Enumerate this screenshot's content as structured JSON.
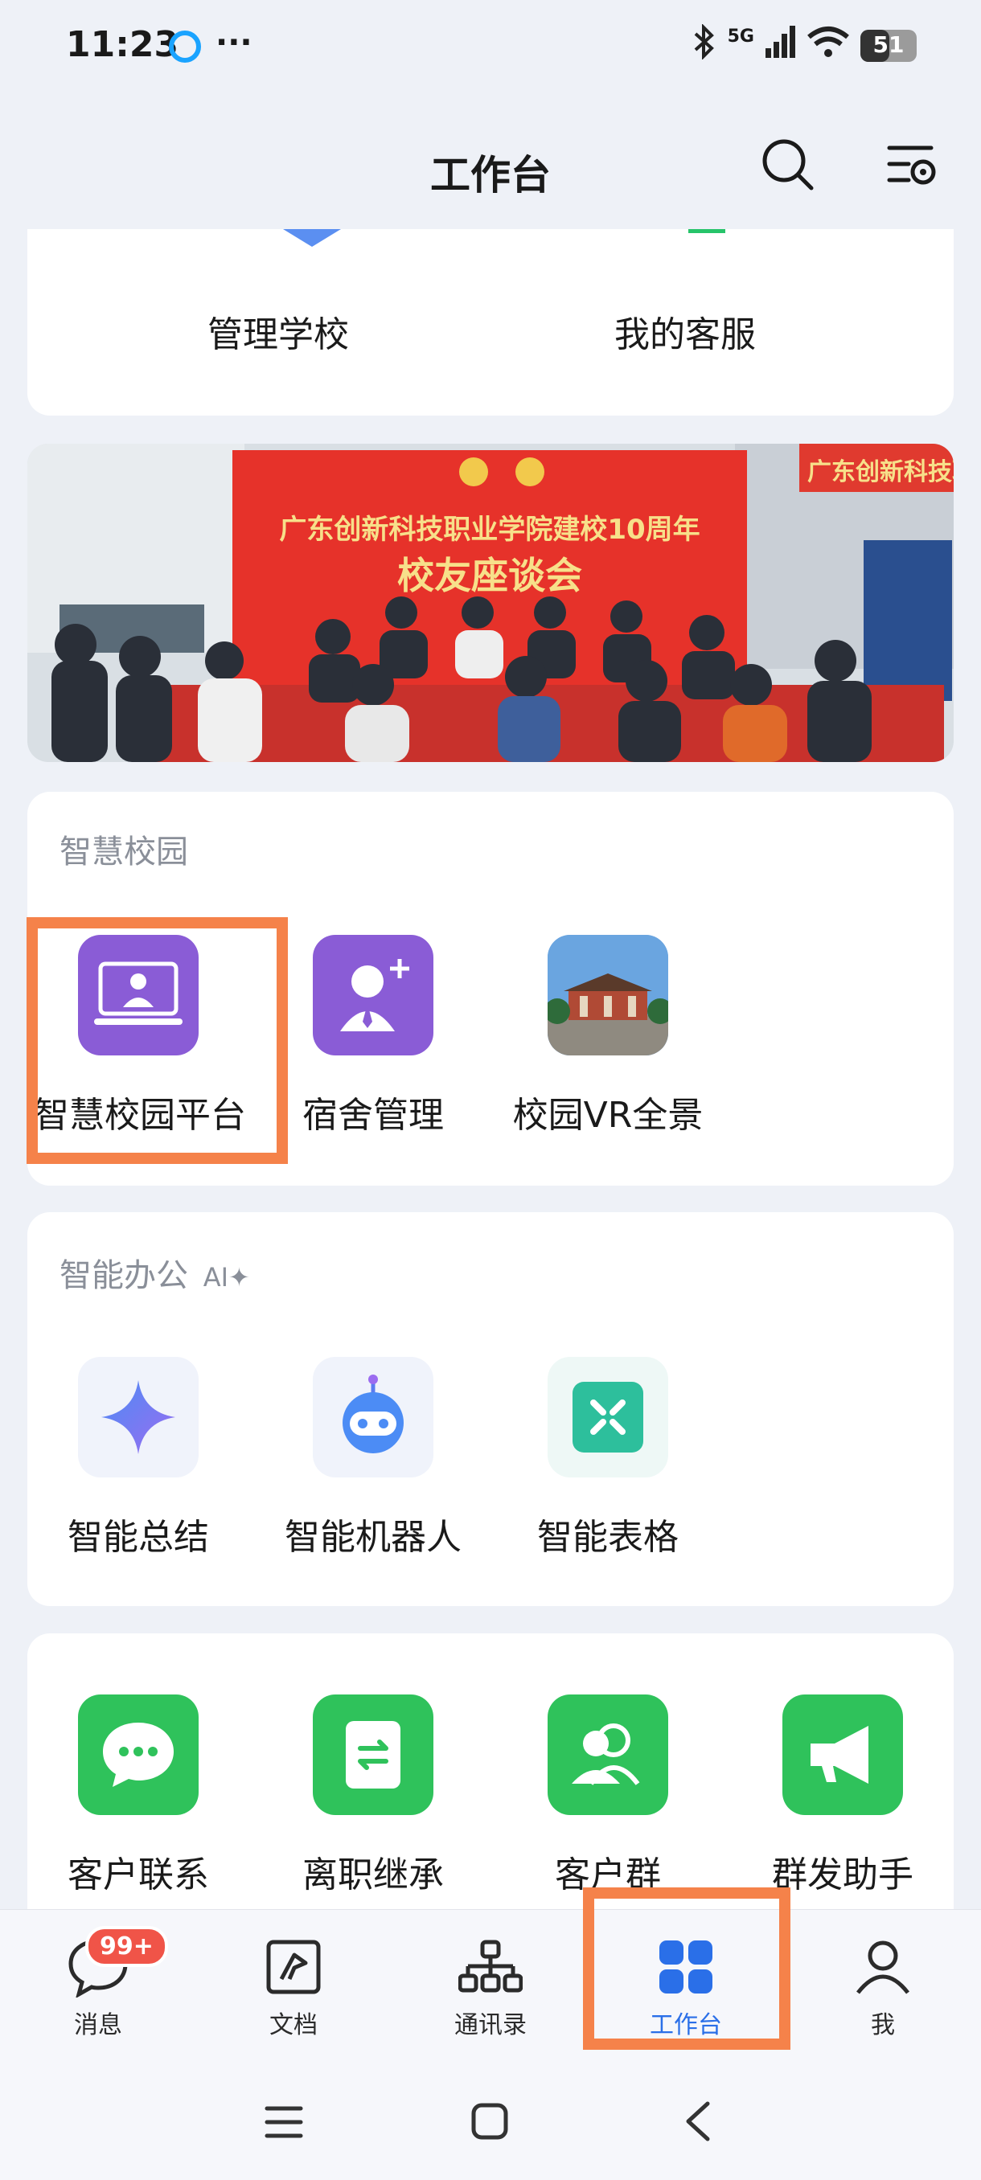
{
  "status": {
    "time": "11:23",
    "dots": "···",
    "network": "5G",
    "battery": "51",
    "battery_level": 0.51
  },
  "header": {
    "title": "工作台"
  },
  "top_card": {
    "items": [
      "管理学校",
      "我的客服"
    ]
  },
  "banner": {
    "school_name": "广东创新科技职业学院建校10周年",
    "event": "校友座谈会",
    "side_sign": "广东创新科技职业学"
  },
  "smart_campus": {
    "title": "智慧校园",
    "apps": [
      {
        "label": "智慧校园平台",
        "icon": "laptop-user-icon"
      },
      {
        "label": "宿舍管理",
        "icon": "add-user-icon"
      },
      {
        "label": "校园VR全景",
        "icon": "campus-building-photo"
      }
    ]
  },
  "smart_office": {
    "title": "智能办公",
    "title_badge": "AI✦",
    "apps": [
      {
        "label": "智能总结",
        "icon": "sparkle-icon"
      },
      {
        "label": "智能机器人",
        "icon": "robot-icon"
      },
      {
        "label": "智能表格",
        "icon": "table-icon"
      }
    ]
  },
  "customer": {
    "apps": [
      {
        "label": "客户联系",
        "icon": "chat-bubble-icon"
      },
      {
        "label": "离职继承",
        "icon": "transfer-icon"
      },
      {
        "label": "客户群",
        "icon": "group-icon"
      },
      {
        "label": "群发助手",
        "icon": "megaphone-icon"
      }
    ]
  },
  "tabbar": {
    "badge": "99+",
    "tabs": [
      {
        "label": "消息"
      },
      {
        "label": "文档"
      },
      {
        "label": "通讯录"
      },
      {
        "label": "工作台",
        "active": true
      },
      {
        "label": "我"
      }
    ]
  },
  "colors": {
    "accent": "#2a6fe8",
    "highlight": "#f5824a",
    "purple": "#8a5cd6",
    "green": "#2fc25b",
    "badge": "#f05448"
  }
}
